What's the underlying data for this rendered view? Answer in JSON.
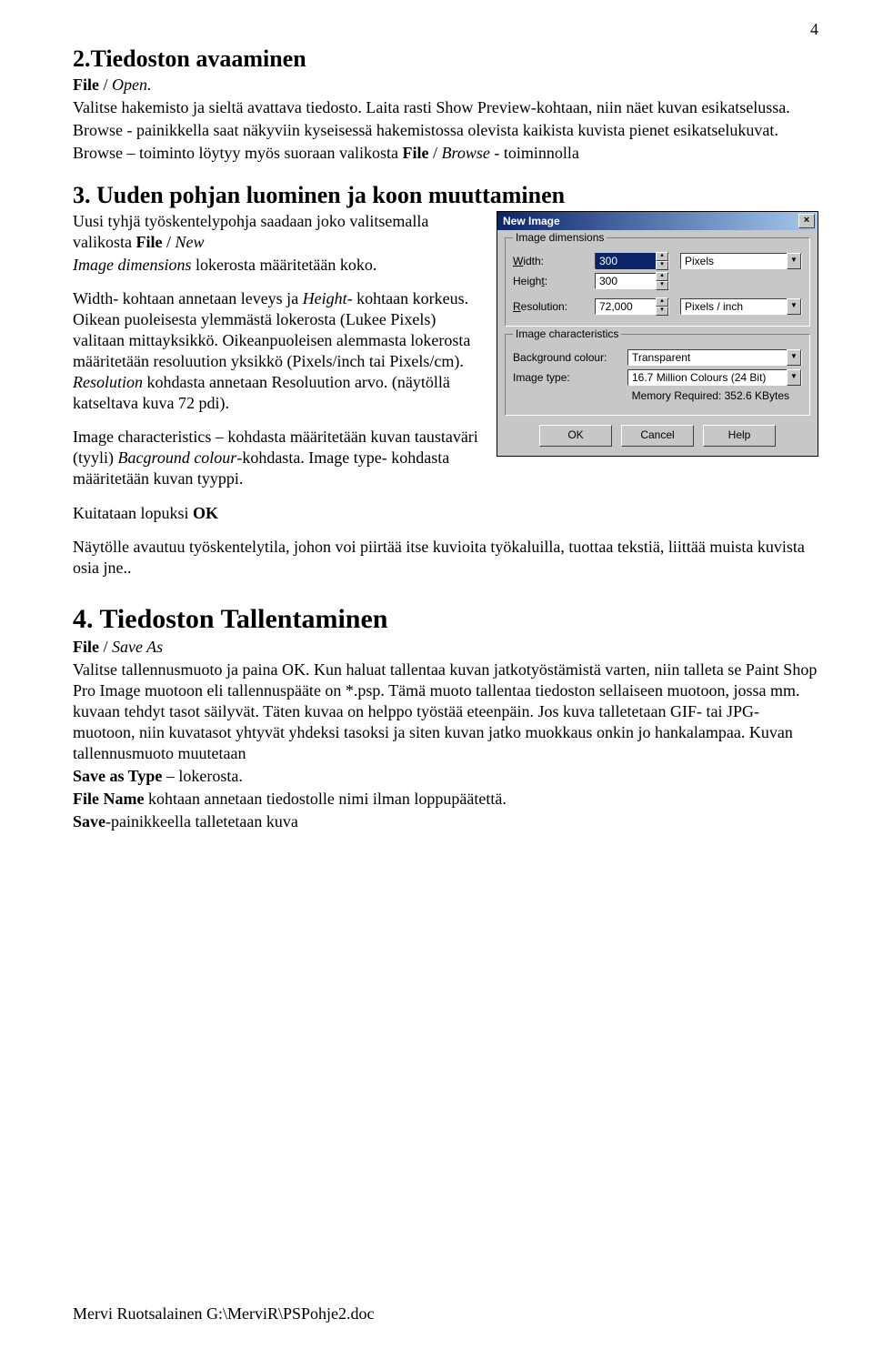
{
  "page_number": "4",
  "sec2": {
    "title": "2.Tiedoston avaaminen",
    "line1_bold": "File",
    "line1_sep": " / ",
    "line1_italic": "Open.",
    "p1": "Valitse hakemisto ja sieltä avattava tiedosto. Laita rasti Show Preview-kohtaan, niin näet kuvan esikatselussa.",
    "p2": "Browse - painikkella saat näkyviin kyseisessä hakemistossa olevista kaikista kuvista pienet esikatselukuvat.",
    "p3a": "Browse – toiminto löytyy myös suoraan valikosta ",
    "p3_bold": "File",
    "p3_sep": " / ",
    "p3_italic": "Browse ",
    "p3b": "- toiminnolla"
  },
  "sec3": {
    "title": "3. Uuden pohjan luominen ja koon muuttaminen",
    "p1a": "Uusi tyhjä työskentelypohja saadaan joko valitsemalla valikosta ",
    "p1_bold": "File",
    "p1_sep": "  /  ",
    "p1_italic": "New",
    "p2_italic": "Image dimensions",
    "p2_rest": " lokerosta määritetään koko.",
    "p3_a": " Width- kohtaan annetaan leveys ja ",
    "p3_italic": "Height",
    "p3_b": "- kohtaan korkeus. Oikean puoleisesta ylemmästä  lokerosta (Lukee Pixels) valitaan mittayksikkö. Oikeanpuoleisen alemmasta lokerosta määritetään resoluution yksikkö (Pixels/inch tai Pixels/cm). ",
    "p3_italic2": "Resolution",
    "p3_c": " kohdasta annetaan Resoluution arvo. (näytöllä katseltava kuva 72 pdi).",
    "p4a": "Image characteristics – kohdasta määritetään kuvan taustaväri (tyyli) ",
    "p4_italic": "Bacground colour",
    "p4b": "-kohdasta. Image type- kohdasta määritetään kuvan tyyppi.",
    "p5a": "Kuitataan lopuksi ",
    "p5_bold": "OK",
    "p6": "Näytölle avautuu työskentelytila, johon voi piirtää itse kuvioita työkaluilla, tuottaa tekstiä, liittää muista kuvista osia jne.."
  },
  "sec4": {
    "title": "4. Tiedoston Tallentaminen",
    "line1_bold": "File ",
    "line1_sep": " / ",
    "line1_italic": "Save As",
    "p1": "Valitse tallennusmuoto ja paina OK. Kun haluat tallentaa kuvan jatkotyöstämistä varten, niin talleta se Paint Shop Pro Image muotoon eli tallennuspääte on *.psp. Tämä muoto tallentaa tiedoston sellaiseen muotoon, jossa mm. kuvaan tehdyt tasot säilyvät. Täten kuvaa on helppo työstää eteenpäin.  Jos kuva talletetaan GIF- tai JPG-muotoon, niin kuvatasot yhtyvät yhdeksi tasoksi ja siten kuvan jatko muokkaus onkin jo hankalampaa.  Kuvan tallennusmuoto muutetaan",
    "p2_bold": "Save as Type",
    "p2_rest": " – lokerosta.",
    "p3_bold": "File Name",
    "p3_rest": " kohtaan annetaan tiedostolle nimi  ilman loppupäätettä.",
    "p4_bold": "Save",
    "p4_rest": "-painikkeella talletetaan kuva"
  },
  "footer": "Mervi Ruotsalainen    G:\\MerviR\\PSPohje2.doc",
  "dialog": {
    "title": "New Image",
    "close_symbol": "×",
    "group1": {
      "legend": "Image dimensions",
      "width_label": "Width:",
      "width_value": "300",
      "height_label": "Height:",
      "height_value": "300",
      "unit": "Pixels",
      "res_label": "Resolution:",
      "res_value": "72,000",
      "res_unit": "Pixels / inch"
    },
    "group2": {
      "legend": "Image characteristics",
      "bg_label": "Background colour:",
      "bg_value": "Transparent",
      "type_label": "Image type:",
      "type_value": "16.7 Million Colours (24 Bit)",
      "memory": "Memory Required: 352.6 KBytes"
    },
    "buttons": {
      "ok": "OK",
      "cancel": "Cancel",
      "help": "Help"
    }
  }
}
